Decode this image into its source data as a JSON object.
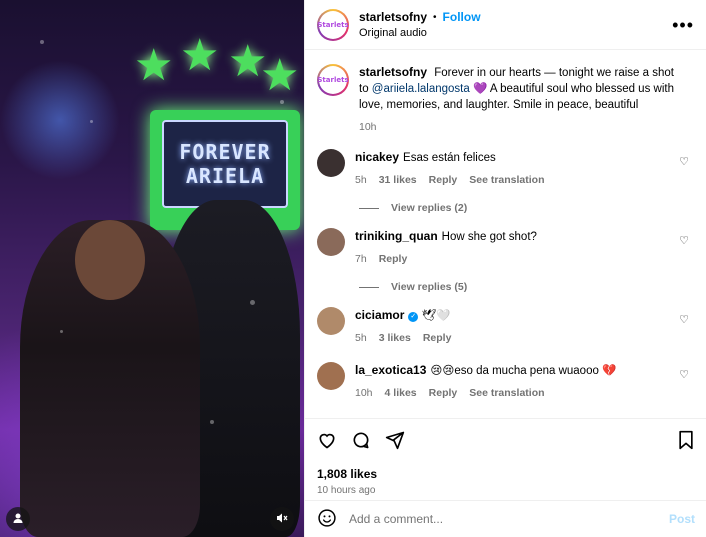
{
  "post": {
    "username": "starletsofny",
    "follow_label": "Follow",
    "audio": "Original audio",
    "more_icon": "more-horizontal-icon",
    "avatar_text": "Starlets"
  },
  "caption": {
    "username": "starletsofny",
    "text_before": "Forever in our hearts — tonight we raise a shot to ",
    "mention": "@ariiela.lalangosta",
    "text_after": " 💜 A beautiful soul who blessed us with love, memories, and laughter. Smile in peace, beautiful",
    "time": "10h"
  },
  "media": {
    "sign_line1": "FOREVER",
    "sign_line2": "ARIELA"
  },
  "comments": [
    {
      "username": "nicakey",
      "text": "Esas están felices",
      "time": "5h",
      "likes": "31 likes",
      "reply": "Reply",
      "translate": "See translation",
      "replies": "View replies (2)",
      "avatar_color": "#3a3030"
    },
    {
      "username": "triniking_quan",
      "text": "How she got shot?",
      "time": "7h",
      "reply": "Reply",
      "replies": "View replies (5)",
      "avatar_color": "#8a6a5a"
    },
    {
      "username": "ciciamor",
      "text": "🕊🤍",
      "time": "5h",
      "likes": "3 likes",
      "reply": "Reply",
      "avatar_color": "#b08a6a"
    },
    {
      "username": "la_exotica13",
      "text": "😢😢eso da mucha pena wuaooo 💔",
      "time": "10h",
      "likes": "4 likes",
      "reply": "Reply",
      "translate": "See translation",
      "avatar_color": "#a07050"
    }
  ],
  "stats": {
    "likes": "1,808 likes",
    "time": "10 hours ago"
  },
  "composer": {
    "placeholder": "Add a comment...",
    "post_label": "Post"
  },
  "colors": {
    "accent": "#0095f6",
    "muted": "#737373",
    "sign_green": "#38d058"
  }
}
